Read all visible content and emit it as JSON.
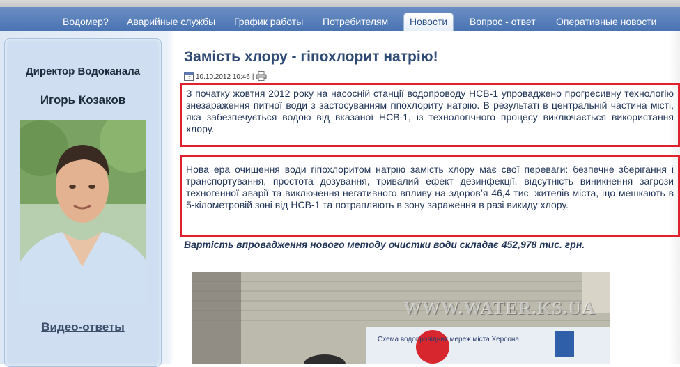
{
  "nav": {
    "items": [
      {
        "label": "Водомер?"
      },
      {
        "label": "Аварийные службы"
      },
      {
        "label": "График работы"
      },
      {
        "label": "Потребителям"
      },
      {
        "label": "Новости",
        "active": true
      },
      {
        "label": "Вопрос - ответ"
      },
      {
        "label": "Оперативные новости"
      }
    ]
  },
  "sidebar": {
    "title": "Директор Водоканала",
    "name": "Игорь Козаков",
    "video_link": "Видео-ответы"
  },
  "article": {
    "title": "Замість хлору - гіпохлорит натрію!",
    "date": "10.10.2012 10:46",
    "separator": "|",
    "paragraph1": "З початку жовтня 2012 року на насосній станції водопроводу НСВ-1 упроваджено прогресивну технологію знезараження питної води з застосуванням гіпохлориту натрію. В результаті в центральній частина місті, яка забезпечується водою від вказаної НСВ-1, із технологічного процесу виключається використання хлору.",
    "paragraph2": "Нова ера очищення води гіпохлоритом натрію замість хлору має свої переваги: безпечне зберігання і транспортування, простота дозування, тривалий ефект дезинфекції, відсутність виникнення загрози техногенної аварії та виключення негативного впливу на здоров’я 46,4 тис. жителів міста, що мешкають в 5-кілометровій зоні від НСВ-1 та потрапляють в зону зараження в разі викиду хлору.",
    "cost": "Вартість впровадження нового методу очистки води складає 452,978 тис. грн.",
    "photo_watermark": "WWW.WATER.KS.UA",
    "photo_banner": "Схема водопровідних мереж міста Херсона"
  },
  "colors": {
    "nav_bg": "#4a74b2",
    "title": "#2f4a75",
    "highlight_border": "#e0202c"
  },
  "icons": {
    "calendar": "calendar-icon",
    "print": "print-icon"
  }
}
